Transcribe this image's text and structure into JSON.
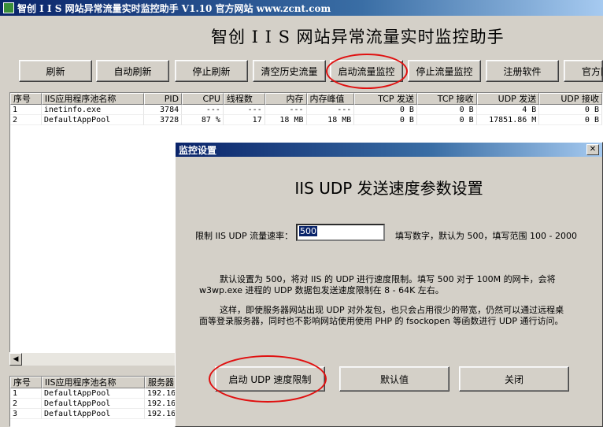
{
  "window": {
    "title": "智创 I I S 网站异常流量实时监控助手 V1.10 官方网站 www.zcnt.com"
  },
  "header": {
    "title": "智创 I I S 网站异常流量实时监控助手"
  },
  "toolbar": {
    "refresh": "刷新",
    "auto_refresh": "自动刷新",
    "stop_refresh": "停止刷新",
    "clear_history": "清空历史流量",
    "start_monitor": "启动流量监控",
    "stop_monitor": "停止流量监控",
    "register": "注册软件",
    "official": "官方网"
  },
  "top_table": {
    "columns": [
      "序号",
      "IIS应用程序池名称",
      "PID",
      "CPU",
      "线程数",
      "内存",
      "内存峰值",
      "TCP 发送",
      "TCP 接收",
      "UDP 发送",
      "UDP 接收"
    ],
    "rows": [
      [
        "1",
        "inetinfo.exe",
        "3784",
        "---",
        "---",
        "---",
        "---",
        "0 B",
        "0 B",
        "4 B",
        "0 B"
      ],
      [
        "2",
        "DefaultAppPool",
        "3728",
        "87 %",
        "17",
        "18 MB",
        "18 MB",
        "0 B",
        "0 B",
        "17851.86 M",
        "0 B"
      ]
    ]
  },
  "bottom_table": {
    "columns": [
      "序号",
      "IIS应用程序池名称",
      "服务器"
    ],
    "rows": [
      [
        "1",
        "DefaultAppPool",
        "192.16"
      ],
      [
        "2",
        "DefaultAppPool",
        "192.16"
      ],
      [
        "3",
        "DefaultAppPool",
        "192.16"
      ]
    ]
  },
  "dialog": {
    "title": "监控设置",
    "close_glyph": "✕",
    "heading": "IIS UDP 发送速度参数设置",
    "rate_label": "限制 IIS UDP 流量速率：",
    "rate_value": "500",
    "rate_hint": "填写数字，默认为 500，填写范围 100 - 2000",
    "paragraph1": "默认设置为 500，将对 IIS 的 UDP 进行速度限制。填写 500 对于 100M 的网卡，会将 w3wp.exe 进程的 UDP 数据包发送速度限制在 8 - 64K 左右。",
    "paragraph2": "这样，即使服务器网站出现 UDP 对外发包，也只会占用很少的带宽，仍然可以通过远程桌面等登录服务器，同时也不影响网站使用使用 PHP 的 fsockopen 等函数进行 UDP 通行访问。",
    "start_button": "启动 UDP 速度限制",
    "default_button": "默认值",
    "close_button": "关闭"
  },
  "colors": {
    "window_bg": "#d4d0c8",
    "titlebar_start": "#0a246a",
    "highlight_oval": "#e01010"
  },
  "icons": {
    "scroll_left": "◀"
  }
}
